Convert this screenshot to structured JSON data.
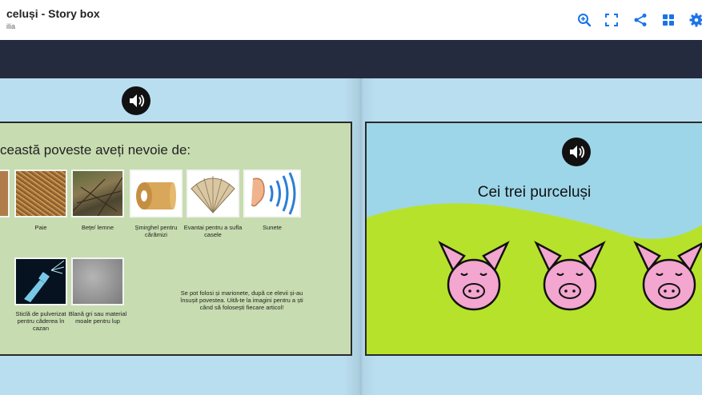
{
  "app": {
    "title": "celuși - Story box",
    "subtitle": "ilia"
  },
  "toolbar": {
    "accent": "#1a73e8",
    "icons": [
      "zoom-in-icon",
      "fullscreen-icon",
      "share-icon",
      "grid-icon",
      "gear-icon"
    ]
  },
  "colors": {
    "navbar": "#252b3e",
    "book_background": "#b9def0",
    "left_page": "#c7dcb0",
    "sky": "#9dd6e8",
    "grass": "#b7e22b",
    "pig": "#f3a6cf"
  },
  "left_page": {
    "heading": "ceastă poveste aveți nevoie de:",
    "items": [
      {
        "label": ""
      },
      {
        "label": "Paie"
      },
      {
        "label": "Bețe/ lemne"
      },
      {
        "label": "Șmirghel pentru cărămizi"
      },
      {
        "label": "Evantai pentru a sufla casele"
      },
      {
        "label": "Sunete"
      },
      {
        "label": "Sticlă de pulverizat pentru căderea în cazan"
      },
      {
        "label": "Blană gri sau material moale pentru lup"
      }
    ],
    "note": "Se pot folosi și marionete, după ce elevii și-au însușit povestea. Uită-te la imagini pentru a ști când să folosești fiecare articol!"
  },
  "right_page": {
    "title": "Cei trei purceluși"
  }
}
